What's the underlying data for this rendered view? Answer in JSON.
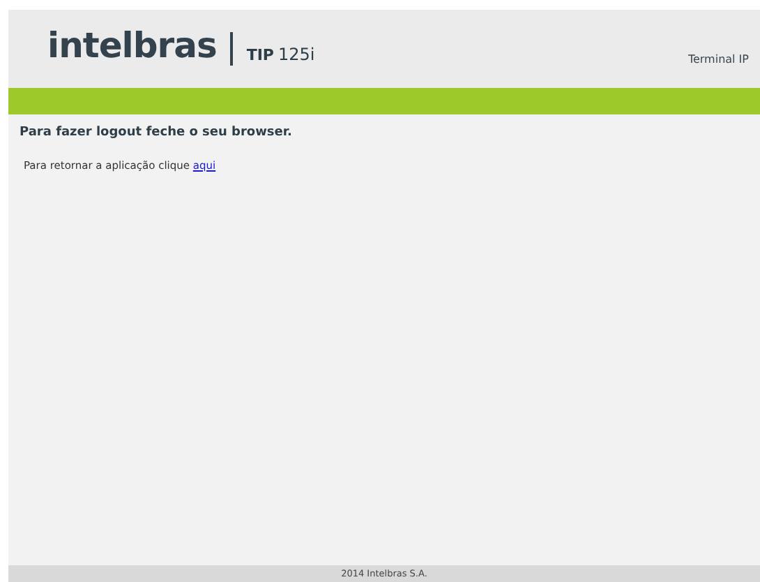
{
  "header": {
    "logo": "intelbras",
    "model_prefix": "TIP",
    "model_number": "125i",
    "product": "Terminal IP"
  },
  "content": {
    "heading": "Para fazer logout feche o seu browser.",
    "text": "Para retornar a aplicação clique ",
    "link": "aqui"
  },
  "footer": "2014 Intelbras S.A."
}
